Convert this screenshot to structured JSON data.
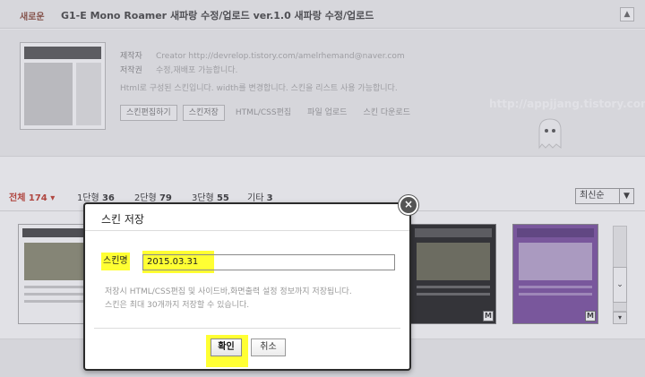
{
  "topbar": {
    "badge": "새로운",
    "title": "G1-E Mono Roamer 새파랑 수정/업로드 ver.1.0 새파랑 수정/업로드",
    "collapse_icon": "chevron-up-icon"
  },
  "info": {
    "rows": [
      {
        "label": "제작자",
        "value": "Creator http://devrelop.tistory.com/amelrhemand@naver.com"
      },
      {
        "label": "저작권",
        "value": "수정,재배포 가능합니다."
      },
      {
        "label": "",
        "value": "Html로 구성된 스킨입니다. width를 변경합니다. 스킨을 리스트 사용 가능합니다."
      }
    ],
    "buttons": [
      "스킨편집하기",
      "스킨저장"
    ],
    "links": [
      "HTML/CSS편집",
      "파일 업로드",
      "스킨 다운로드"
    ]
  },
  "watermark": "http://appjjang.tistory.com",
  "filters": {
    "items": [
      {
        "label": "전체",
        "count": "174",
        "active": true
      },
      {
        "label": "1단형",
        "count": "36",
        "active": false
      },
      {
        "label": "2단형",
        "count": "79",
        "active": false
      },
      {
        "label": "3단형",
        "count": "55",
        "active": false
      },
      {
        "label": "기타",
        "count": "3",
        "active": false
      }
    ],
    "sort": "최신순"
  },
  "gallery": {
    "badge": "M"
  },
  "modal": {
    "title": "스킨 저장",
    "name_label": "스킨명",
    "name_value": "2015.03.31",
    "help_line1": "저장시 HTML/CSS편집 및 사이드바,화면출력 설정 정보까지 저장됩니다.",
    "help_line2": "스킨은 최대 30개까지 저장할 수 있습니다.",
    "ok_label": "확인",
    "cancel_label": "취소",
    "close_icon": "close-icon"
  }
}
